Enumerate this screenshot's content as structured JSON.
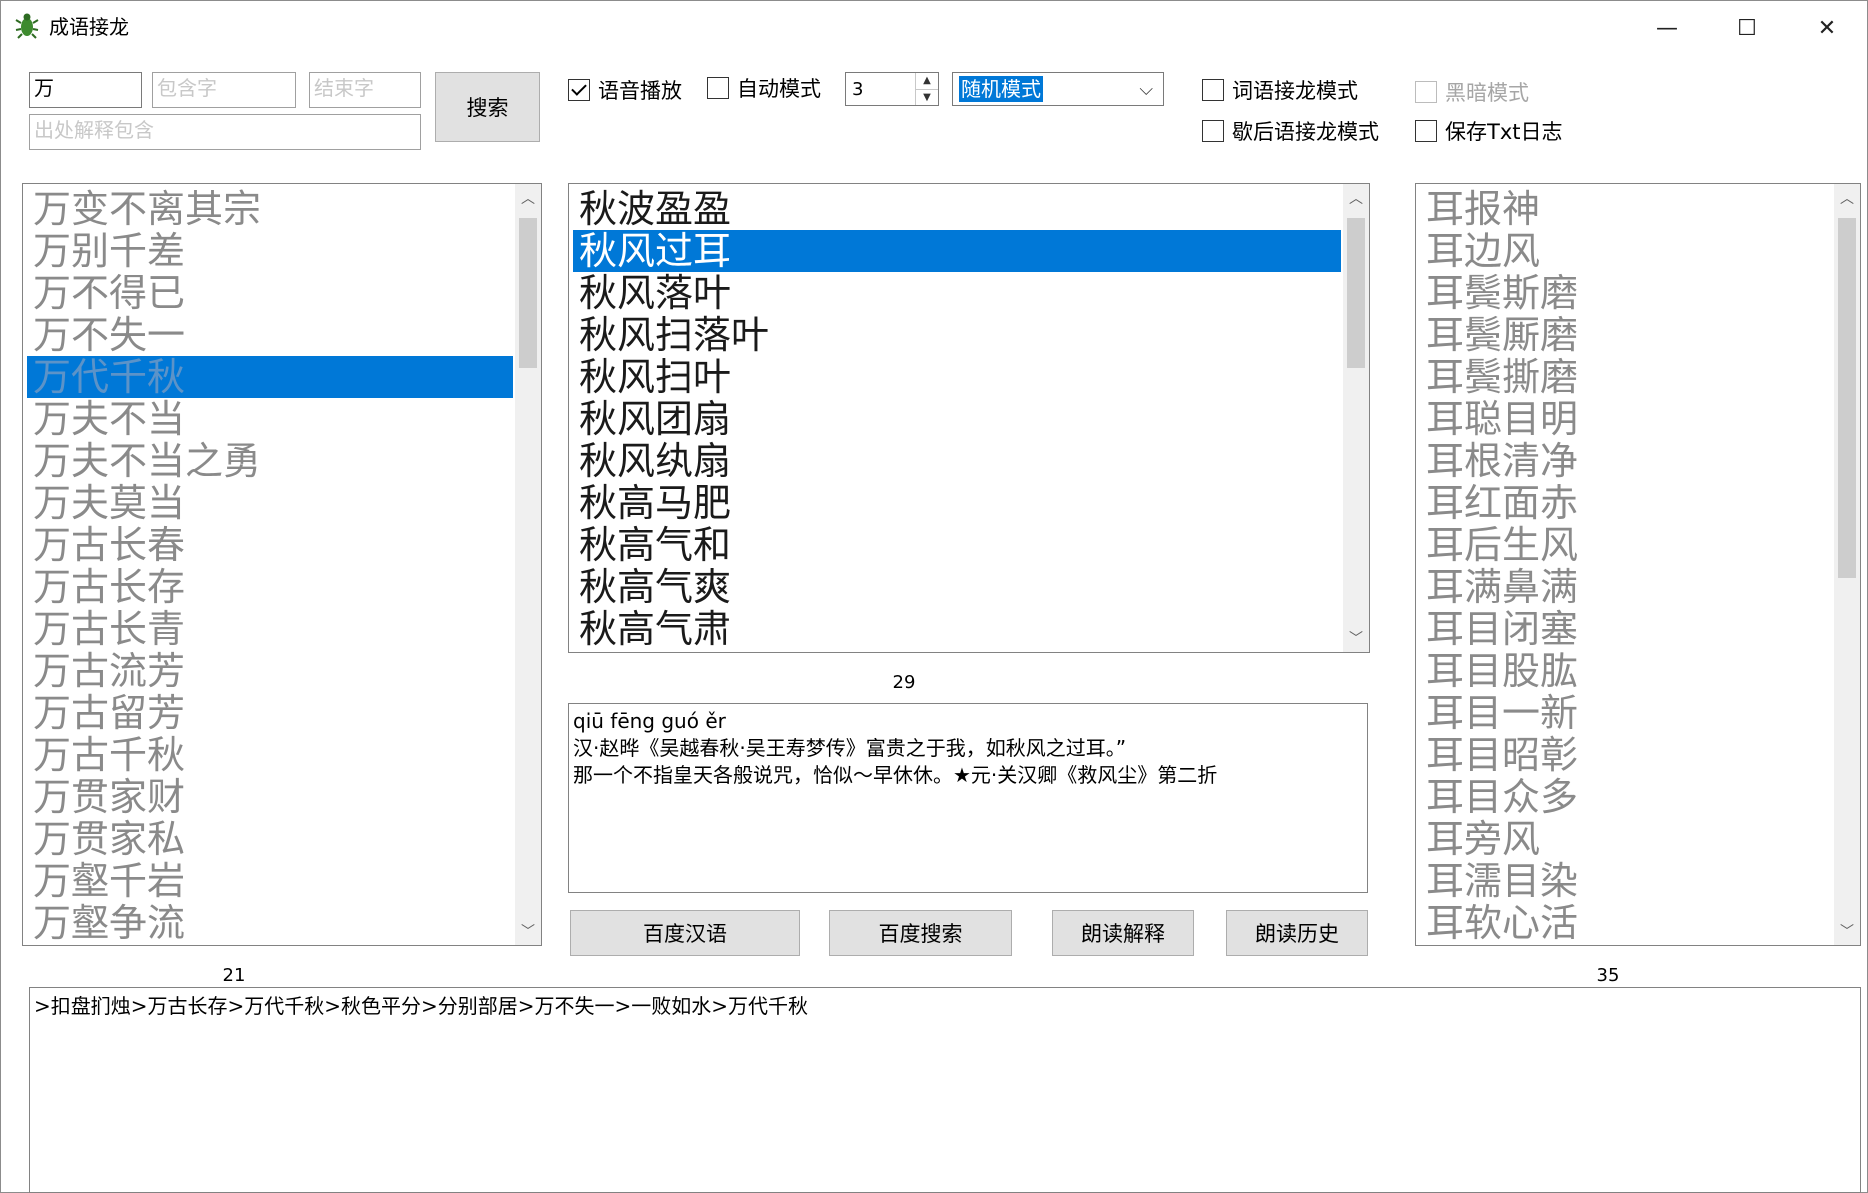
{
  "window": {
    "title": "成语接龙",
    "minimize_glyph": "—",
    "maximize_glyph": "☐",
    "close_glyph": "✕"
  },
  "search": {
    "start_char_value": "万",
    "contains_placeholder": "包含字",
    "end_char_placeholder": "结束字",
    "source_placeholder": "出处解释包含",
    "search_label": "搜索"
  },
  "options": {
    "voice_play": {
      "label": "语音播放",
      "checked": true
    },
    "auto_mode": {
      "label": "自动模式",
      "checked": false
    },
    "auto_count": "3",
    "mode_select": "随机模式",
    "word_chain_mode": {
      "label": "词语接龙模式",
      "checked": false
    },
    "xiehouyu_mode": {
      "label": "歇后语接龙模式",
      "checked": false
    },
    "dark_mode": {
      "label": "黑暗模式",
      "checked": false,
      "disabled": true
    },
    "save_txt_log": {
      "label": "保存Txt日志",
      "checked": false
    }
  },
  "left_list": {
    "items": [
      "万变不离其宗",
      "万别千差",
      "万不得已",
      "万不失一",
      "万代千秋",
      "万夫不当",
      "万夫不当之勇",
      "万夫莫当",
      "万古长春",
      "万古长存",
      "万古长青",
      "万古流芳",
      "万古留芳",
      "万古千秋",
      "万贯家财",
      "万贯家私",
      "万壑千岩",
      "万壑争流"
    ],
    "selected_index": 4,
    "count": "21"
  },
  "middle_list": {
    "items": [
      "秋波盈盈",
      "秋风过耳",
      "秋风落叶",
      "秋风扫落叶",
      "秋风扫叶",
      "秋风团扇",
      "秋风纨扇",
      "秋高马肥",
      "秋高气和",
      "秋高气爽",
      "秋高气肃"
    ],
    "selected_index": 1,
    "count": "29"
  },
  "right_list": {
    "items": [
      "耳报神",
      "耳边风",
      "耳鬓斯磨",
      "耳鬓厮磨",
      "耳鬓撕磨",
      "耳聪目明",
      "耳根清净",
      "耳红面赤",
      "耳后生风",
      "耳满鼻满",
      "耳目闭塞",
      "耳目股肱",
      "耳目一新",
      "耳目昭彰",
      "耳目众多",
      "耳旁风",
      "耳濡目染",
      "耳软心活"
    ],
    "count": "35"
  },
  "explanation": {
    "text": "qiū fēng guó ěr\n汉·赵晔《吴越春秋·吴王寿梦传》富贵之于我，如秋风之过耳。”\n那一个不指皇天各般说咒，恰似～早休休。★元·关汉卿《救风尘》第二折"
  },
  "action_buttons": {
    "baidu_hanyu": "百度汉语",
    "baidu_search": "百度搜索",
    "read_explanation": "朗读解释",
    "read_history": "朗读历史"
  },
  "history": {
    "text": ">扣盘扪烛>万古长存>万代千秋>秋色平分>分别部居>万不失一>一败如水>万代千秋"
  }
}
